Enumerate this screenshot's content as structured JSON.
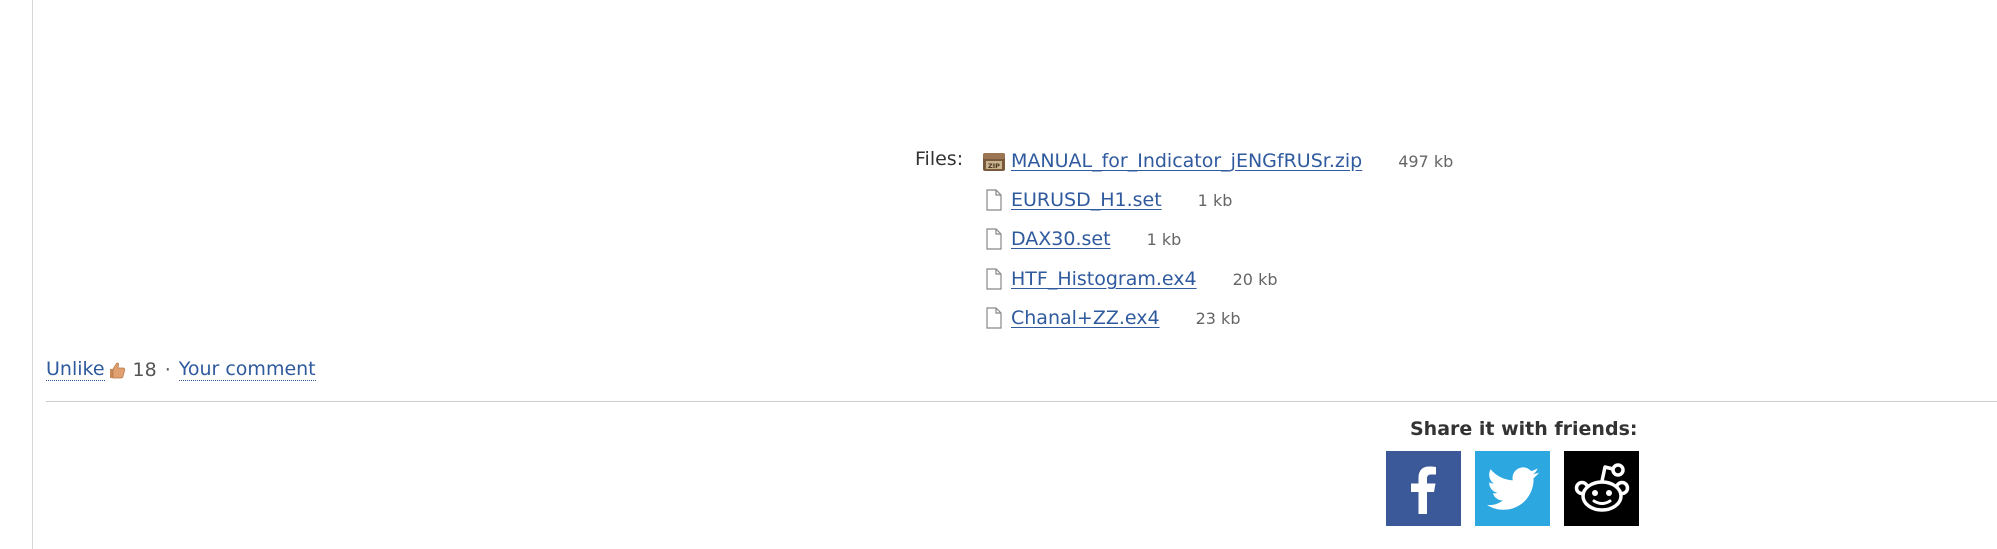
{
  "files": {
    "label": "Files:",
    "items": [
      {
        "name": "MANUAL_for_Indicator_jENGfRUSr.zip",
        "size": "497 kb",
        "icon": "zip-archive-icon"
      },
      {
        "name": "EURUSD_H1.set",
        "size": "1 kb",
        "icon": "file-icon"
      },
      {
        "name": "DAX30.set",
        "size": "1 kb",
        "icon": "file-icon"
      },
      {
        "name": "HTF_Histogram.ex4",
        "size": "20 kb",
        "icon": "file-icon"
      },
      {
        "name": "Chanal+ZZ.ex4",
        "size": "23 kb",
        "icon": "file-icon"
      }
    ]
  },
  "actions": {
    "unlike_label": "Unlike",
    "like_count": "18",
    "separator": "·",
    "comment_label": "Your comment"
  },
  "share": {
    "title": "Share it with friends:",
    "networks": [
      "facebook",
      "twitter",
      "reddit"
    ],
    "colors": {
      "facebook": "#3b5998",
      "twitter": "#2ca7e0",
      "reddit": "#000000"
    }
  },
  "colors": {
    "link": "#2f5a9e"
  }
}
